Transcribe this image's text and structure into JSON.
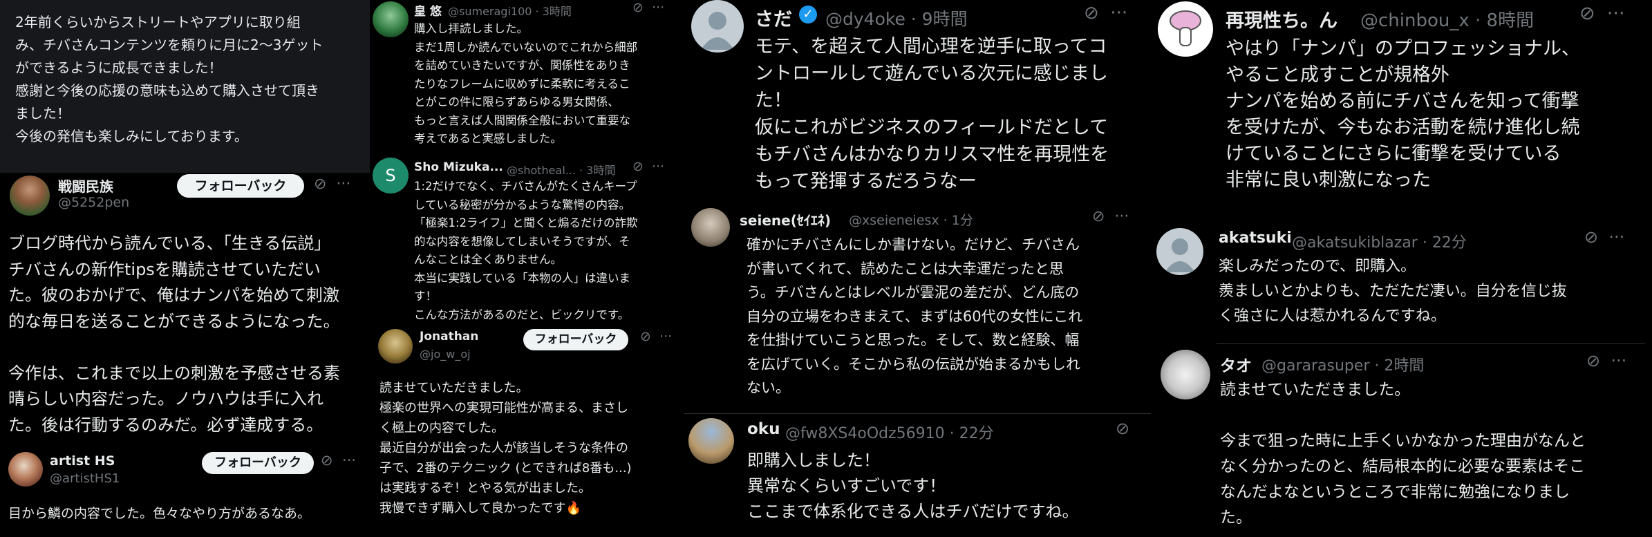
{
  "follow_back_label": "フォローバック",
  "panels": {
    "p1": {
      "top_text": "2年前くらいからストリートやアプリに取り組\nみ、チバさんコンテンツを頼りに月に2〜3ゲット\nができるように成長できました！\n感謝と今後の応援の意味も込めて購入させて頂き\nました！\n今後の発信も楽しみにしております。",
      "posts": [
        {
          "name": "戦闘民族",
          "handle": "@5252pen",
          "text": "ブログ時代から読んでいる、「生きる伝説」\nチバさんの新作tipsを購読させていただい\nた。彼のおかげで、俺はナンパを始めて刺激\n的な毎日を送ることができるようになった。\n\n今作は、これまで以上の刺激を予感させる素\n晴らしい内容だった。ノウハウは手に入れ\nた。後は行動するのみだ。必ず達成する。"
        },
        {
          "name": "artist HS",
          "handle": "@artistHS1",
          "text": "目から鱗の内容でした。色々なやり方があるなあ。"
        }
      ]
    },
    "p2": {
      "posts": [
        {
          "name": "皇 悠",
          "handle": "@sumeragi100 · 3時間",
          "text": "購入し拝読しました。\nまだ1周しか読んでいないのでこれから細部\nを詰めていきたいですが、関係性をありき\nたりなフレームに収めずに柔軟に考えるこ\nとがこの件に限らずあらゆる男女関係、\nもっと言えば人間関係全般において重要な\n考えであると実感しました。"
        },
        {
          "name": "Sho Mizuka...",
          "handle": "@shotheal... · 3時間",
          "avatar_letter": "S",
          "text": "1:2だけでなく、チバさんがたくさんキープ\nしている秘密が分かるような驚愕の内容。\n「極楽1:2ライフ」と聞くと煽るだけの詐欺\n的な内容を想像してしまいそうですが、そ\nんなことは全くありません。\n本当に実践している「本物の人」は違いま\nす！\nこんな方法があるのだと、ビックリです。"
        },
        {
          "name": "Jonathan",
          "handle": "@jo_w_oj",
          "text": "読ませていただきました。\n極楽の世界への実現可能性が高まる、まさし\nく極上の内容でした。\n最近自分が出会った人が該当しそうな条件の\n子で、2番のテクニック (とできれば8番も...)\nは実践するぞ！とやる気が出ました。\n我慢できず購入して良かったです🔥"
        }
      ]
    },
    "p3": {
      "posts": [
        {
          "name": "さだ",
          "handle": "@dy4oke · 9時間",
          "text": "モテ、を超えて人間心理を逆手に取ってコ\nントロールして遊んでいる次元に感じまし\nた！\n仮にこれがビジネスのフィールドだとして\nもチバさんはかなりカリスマ性を再現性を\nもって発揮するだろうなー"
        },
        {
          "name": "seiene(ｾｲｴﾈ)",
          "handle": "@xseieneiesx · 1分",
          "text": "確かにチバさんにしか書けない。だけど、チバさん\nが書いてくれて、読めたことは大幸運だったと思\nう。チバさんとはレベルが雲泥の差だが、どん底の\n自分の立場をわきまえて、まずは60代の女性にこれ\nを仕掛けていこうと思った。そして、数と経験、幅\nを広げていく。そこから私の伝説が始まるかもしれ\nない。"
        },
        {
          "name": "oku",
          "handle": "@fw8XS4oOdz56910 · 22分",
          "text": "即購入しました！\n異常なくらいすごいです！\nここまで体系化できる人はチバだけですね。"
        }
      ]
    },
    "p4": {
      "posts": [
        {
          "name": "再現性ち。ん",
          "handle": "@chinbou_x · 8時間",
          "text": "やはり「ナンパ」のプロフェッショナル、\nやること成すことが規格外\nナンパを始める前にチバさんを知って衝撃\nを受けたが、今もなお活動を続け進化し続\nけていることにさらに衝撃を受けている\n非常に良い刺激になった"
        },
        {
          "name": "akatsuki",
          "handle": "@akatsukiblazar · 22分",
          "text": "楽しみだったので、即購入。\n羨ましいとかよりも、ただただ凄い。自分を信じ抜\nく強さに人は惹かれるんですね。"
        },
        {
          "name": "タオ",
          "handle": "@gararasuper · 2時間",
          "text": "読ませていただきました。\n\n今まで狙った時に上手くいかなかった理由がなんと\nなく分かったのと、結局根本的に必要な要素はそこ\nなんだよなというところで非常に勉強になりまし\nた。"
        }
      ]
    }
  }
}
